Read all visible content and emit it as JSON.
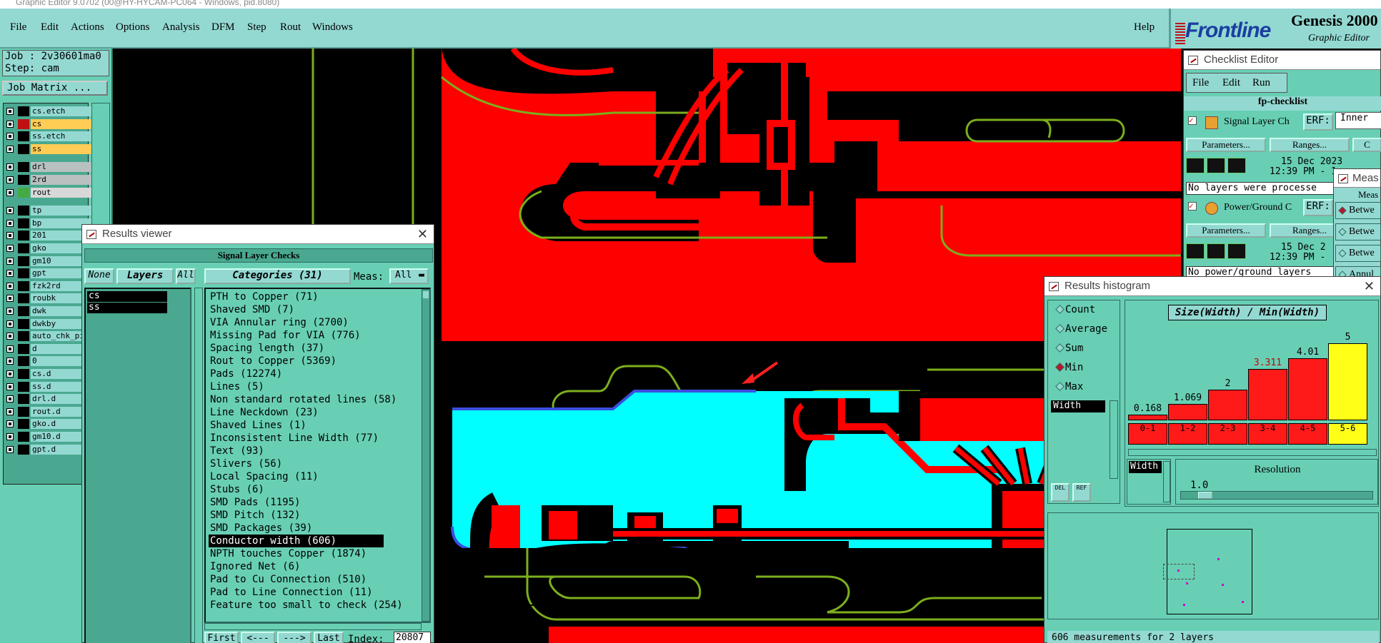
{
  "window_title": "Graphic Editor 9.0702 (00@HY-HYCAM-PC064 - Windows, pid.8080)",
  "menu": {
    "file": "File",
    "edit": "Edit",
    "actions": "Actions",
    "options": "Options",
    "analysis": "Analysis",
    "dfm": "DFM",
    "step": "Step",
    "rout": "Rout",
    "windows": "Windows",
    "help": "Help"
  },
  "brand": {
    "logo": "Frontline",
    "product": "Genesis 2000",
    "subtitle": "Graphic Editor"
  },
  "job": {
    "job_label": "Job : 2v30601ma0",
    "step_label": "Step: cam",
    "job_matrix": "Job Matrix ..."
  },
  "layers": [
    {
      "name": "cs.etch",
      "color": "#000000",
      "bg": "#93d9d2"
    },
    {
      "name": "cs",
      "color": "#c01010",
      "bg": "#ffcc55"
    },
    {
      "name": "ss.etch",
      "color": "#000000",
      "bg": "#93d9d2"
    },
    {
      "name": "ss",
      "color": "#000000",
      "bg": "#ffcc55"
    },
    {
      "name": "drl",
      "color": "#000000",
      "bg": "#b8c0c0"
    },
    {
      "name": "2rd",
      "color": "#000000",
      "bg": "#b8c0c0"
    },
    {
      "name": "rout",
      "color": "#44aa44",
      "bg": "#d8d8d8"
    },
    {
      "name": "tp",
      "color": "#000000",
      "bg": "#93d9d2"
    },
    {
      "name": "bp",
      "color": "#000000",
      "bg": "#93d9d2"
    },
    {
      "name": "201",
      "color": "#000000",
      "bg": "#93d9d2"
    },
    {
      "name": "gko",
      "color": "#000000",
      "bg": "#93d9d2"
    },
    {
      "name": "gm10",
      "color": "#000000",
      "bg": "#93d9d2"
    },
    {
      "name": "gpt",
      "color": "#000000",
      "bg": "#93d9d2"
    },
    {
      "name": "fzk2rd",
      "color": "#000000",
      "bg": "#93d9d2"
    },
    {
      "name": "roubk",
      "color": "#000000",
      "bg": "#93d9d2"
    },
    {
      "name": "dwk",
      "color": "#000000",
      "bg": "#93d9d2"
    },
    {
      "name": "dwkby",
      "color": "#000000",
      "bg": "#93d9d2"
    },
    {
      "name": "auto_chk_pi",
      "color": "#000000",
      "bg": "#93d9d2"
    },
    {
      "name": "d",
      "color": "#000000",
      "bg": "#93d9d2"
    },
    {
      "name": "0",
      "color": "#000000",
      "bg": "#93d9d2"
    },
    {
      "name": "cs.d",
      "color": "#000000",
      "bg": "#93d9d2"
    },
    {
      "name": "ss.d",
      "color": "#000000",
      "bg": "#93d9d2"
    },
    {
      "name": "drl.d",
      "color": "#000000",
      "bg": "#93d9d2"
    },
    {
      "name": "rout.d",
      "color": "#000000",
      "bg": "#93d9d2"
    },
    {
      "name": "gko.d",
      "color": "#000000",
      "bg": "#93d9d2"
    },
    {
      "name": "gm10.d",
      "color": "#000000",
      "bg": "#93d9d2"
    },
    {
      "name": "gpt.d",
      "color": "#000000",
      "bg": "#93d9d2"
    }
  ],
  "results_viewer": {
    "title": "Results viewer",
    "band": "Signal Layer Checks",
    "none": "None",
    "layers": "Layers",
    "all": "All",
    "categories": "Categories (31)",
    "meas_label": "Meas:",
    "meas_value": "All",
    "layer_rows": [
      "cs",
      "ss"
    ],
    "category_items": [
      "PTH to Copper (71)",
      "Shaved SMD (7)",
      "VIA Annular ring (2700)",
      "Missing Pad for VIA (776)",
      "Spacing length (37)",
      "Rout to Copper (5369)",
      "Pads (12274)",
      "Lines (5)",
      "Non standard rotated lines (58)",
      "Line Neckdown (23)",
      "Shaved Lines (1)",
      "Inconsistent Line Width (77)",
      "Text (93)",
      "Slivers (56)",
      "Local Spacing (11)",
      "Stubs (6)",
      "SMD Pads (1195)",
      "SMD Pitch (132)",
      "SMD Packages (39)",
      "Conductor width (606)",
      "NPTH touches Copper (1874)",
      "Ignored Net (6)",
      "Pad to Cu Connection (510)",
      "Pad to Line Connection (11)",
      "Feature too small to check (254)"
    ],
    "selected_index": 19,
    "nav": {
      "first": "First",
      "prev": "<---",
      "next": "--->",
      "last": "Last",
      "index_label": "Index:",
      "index_value": "20807"
    }
  },
  "checklist": {
    "title": "Checklist Editor",
    "menu": {
      "file": "File",
      "edit": "Edit",
      "run": "Run"
    },
    "name": "fp-checklist",
    "row1": {
      "label": "Signal Layer Ch",
      "erf": "ERF:",
      "erf_value": "Inner",
      "params": "Parameters...",
      "ranges": "Ranges...",
      "extra": "C",
      "date": "15 Dec 2023",
      "time": "12:39 PM - 1",
      "status": "No layers were processe"
    },
    "row2": {
      "label": "Power/Ground C",
      "erf": "ERF:",
      "params": "Parameters...",
      "ranges": "Ranges...",
      "date": "15 Dec 2",
      "time": "12:39 PM -",
      "status": "No power/ground layers"
    }
  },
  "measure": {
    "title": "Meas",
    "header": "Meas",
    "items": [
      "Betwe",
      "Betwe",
      "Betwe",
      "Annul"
    ]
  },
  "histogram": {
    "title": "Results histogram",
    "options": [
      "Count",
      "Average",
      "Sum",
      "Min",
      "Max"
    ],
    "selected_option": "Min",
    "attr_value": "Width",
    "expr": "Size(Width) / Min(Width)",
    "bars": [
      {
        "label": "0.168",
        "bin": "0-1",
        "value": 0.168
      },
      {
        "label": "1.069",
        "bin": "1-2",
        "value": 1.069
      },
      {
        "label": "2",
        "bin": "2-3",
        "value": 2
      },
      {
        "label": "3.311",
        "bin": "3-4",
        "value": 3.311
      },
      {
        "label": "4.01",
        "bin": "4-5",
        "value": 4.01
      },
      {
        "label": "5",
        "bin": "5-6",
        "value": 5
      }
    ],
    "highlight_bin": 5,
    "label_red_index": 3,
    "del": "DEL",
    "ref": "REF",
    "width_field": "Width",
    "resolution_label": "Resolution",
    "resolution_value": "1.0",
    "footer": "606 measurements for 2 layers"
  }
}
